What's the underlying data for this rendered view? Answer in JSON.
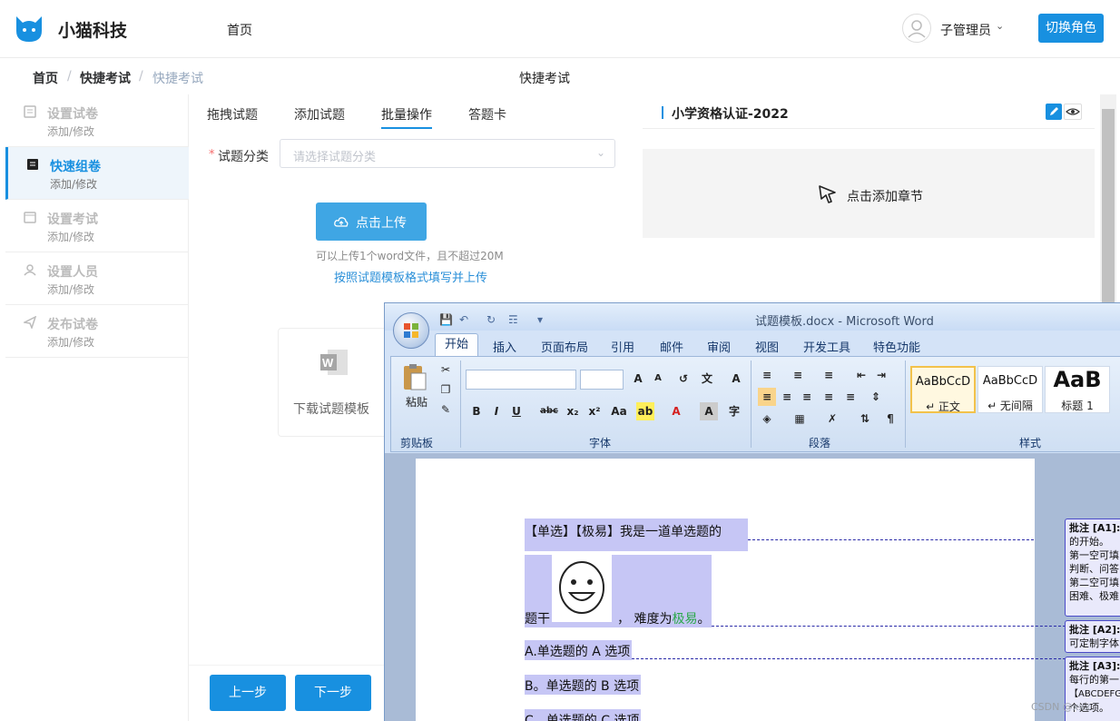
{
  "header": {
    "app_name": "小猫科技",
    "nav_home": "首页",
    "user_name": "子管理员",
    "switch_role": "切换角色"
  },
  "breadcrumb": {
    "items": [
      "首页",
      "快捷考试",
      "快捷考试"
    ],
    "separator": "/",
    "center_title": "快捷考试"
  },
  "sidebar": {
    "items": [
      {
        "title": "设置试卷",
        "sub": "添加/修改",
        "icon": "document-icon"
      },
      {
        "title": "快速组卷",
        "sub": "添加/修改",
        "icon": "file-text-icon",
        "active": true
      },
      {
        "title": "设置考试",
        "sub": "添加/修改",
        "icon": "calendar-icon"
      },
      {
        "title": "设置人员",
        "sub": "添加/修改",
        "icon": "user-icon"
      },
      {
        "title": "发布试卷",
        "sub": "添加/修改",
        "icon": "send-icon"
      }
    ]
  },
  "tabs": [
    "拖拽试题",
    "添加试题",
    "批量操作",
    "答题卡"
  ],
  "active_tab": "批量操作",
  "form": {
    "required_mark": "*",
    "category_label": "试题分类",
    "category_placeholder": "请选择试题分类",
    "upload_button": "点击上传",
    "upload_hint": "可以上传1个word文件，且不超过20M",
    "template_link": "按照试题模板格式填写并上传",
    "download_template": "下载试题模板"
  },
  "footer_buttons": {
    "prev": "上一步",
    "next": "下一步"
  },
  "right_panel": {
    "title": "小学资格认证-2022",
    "add_chapter": "点击添加章节"
  },
  "word": {
    "title": "试题模板.docx - Microsoft Word",
    "tabs": [
      "开始",
      "插入",
      "页面布局",
      "引用",
      "邮件",
      "审阅",
      "视图",
      "开发工具",
      "特色功能"
    ],
    "groups": {
      "clipboard": "剪贴板",
      "font": "字体",
      "paragraph": "段落",
      "styles": "样式"
    },
    "paste": "粘贴",
    "styles": [
      {
        "sample": "AaBbCcD",
        "name": "↵ 正文"
      },
      {
        "sample": "AaBbCcD",
        "name": "↵ 无间隔"
      },
      {
        "sample": "AaB",
        "name": "标题 1"
      }
    ],
    "doc": {
      "line1": "【单选】【极易】我是一道单选题的",
      "stem_prefix": "题干",
      "stem_mid": "， 难度为",
      "stem_level": "极易",
      "stem_end": "。",
      "option_a": "A.单选题的 A 选项",
      "option_b": "B。单选题的 B 选项",
      "option_c": "C、单选题的 C 选项"
    },
    "comments": [
      {
        "head": "批注 [A1]:",
        "lines": [
          "的开始。",
          "第一空可填",
          "判断、问答",
          "第二空可填",
          "困难、极难"
        ]
      },
      {
        "head": "批注 [A2]:",
        "lines": [
          "可定制字体"
        ]
      },
      {
        "head": "批注 [A3]:",
        "lines": [
          "每行的第一",
          "【ABCDEFG",
          "个选项。"
        ]
      }
    ]
  },
  "watermark": "CSDN @xxx",
  "colors": {
    "primary": "#1890e0",
    "word_ribbon": "#d4e3f7"
  }
}
